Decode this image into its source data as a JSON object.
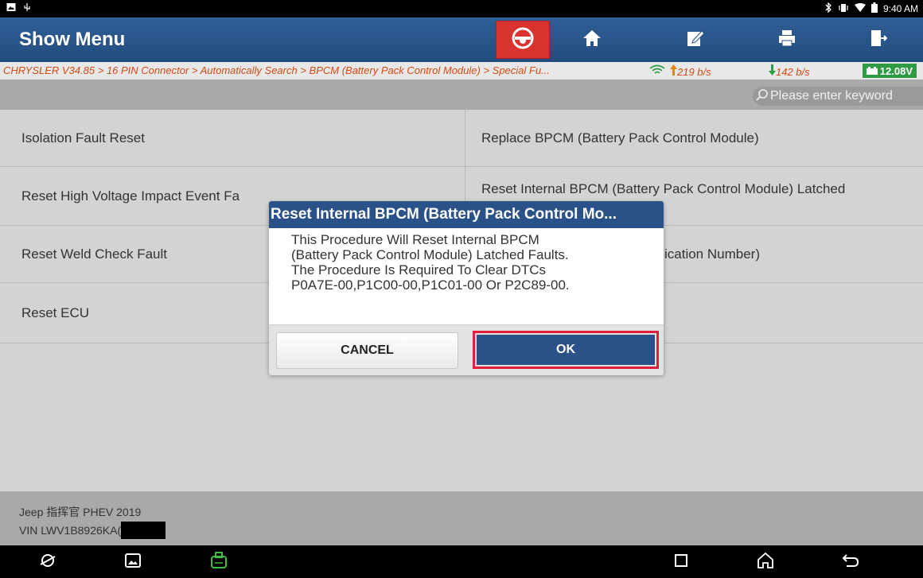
{
  "status_bar": {
    "time": "9:40 AM"
  },
  "header": {
    "title": "Show Menu"
  },
  "breadcrumb": {
    "path": "CHRYSLER V34.85 > 16 PIN Connector > Automatically Search > BPCM (Battery Pack Control Module) > Special Fu...",
    "upload_speed": "219 b/s",
    "download_speed": "142 b/s",
    "voltage": "12.08V"
  },
  "search": {
    "placeholder": "Please enter keyword"
  },
  "menu": {
    "items": [
      {
        "label": "Isolation Fault Reset"
      },
      {
        "label": "Replace BPCM (Battery Pack Control Module)"
      },
      {
        "label": "Reset High Voltage Impact Event Fa"
      },
      {
        "label": "Reset Internal BPCM (Battery Pack Control Module) Latched"
      },
      {
        "label": "Reset Weld Check Fault"
      },
      {
        "label": "ication Number)"
      },
      {
        "label": "Reset ECU"
      }
    ]
  },
  "footer": {
    "vehicle": "Jeep 指挥官 PHEV 2019",
    "vin": "VIN LWV1B8926KA("
  },
  "dialog": {
    "title": "Reset Internal BPCM (Battery Pack Control Mo...",
    "message_lines": [
      "This Procedure Will Reset Internal BPCM",
      "(Battery Pack Control Module) Latched Faults.",
      "The Procedure Is Required To Clear DTCs",
      "P0A7E-00,P1C00-00,P1C01-00 Or P2C89-00."
    ],
    "cancel_label": "CANCEL",
    "ok_label": "OK"
  },
  "colors": {
    "header": "#2b5288",
    "crumb_text": "#d44a12",
    "voltage_bg": "#2e9b44",
    "highlight": "#e0203a"
  }
}
